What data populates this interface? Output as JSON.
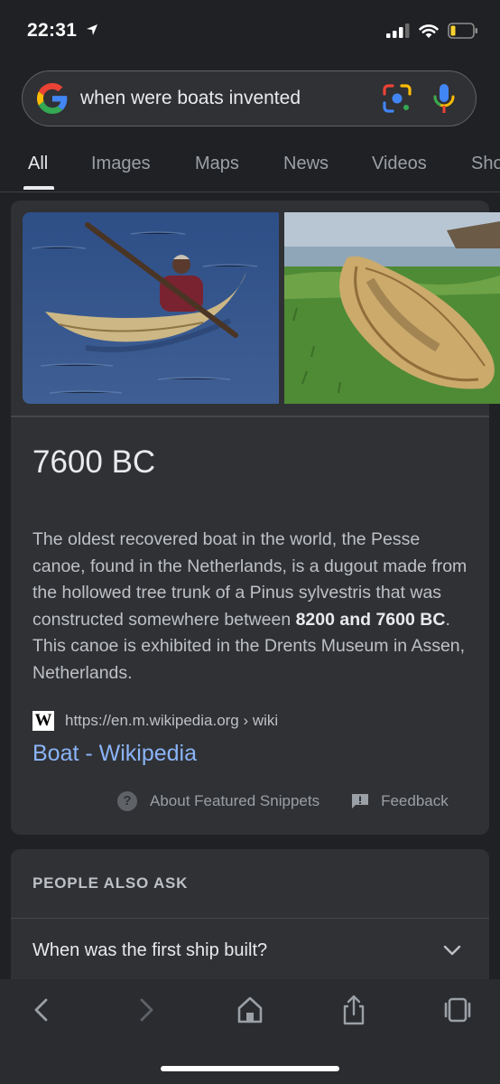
{
  "status": {
    "time": "22:31"
  },
  "search": {
    "query": "when were boats invented"
  },
  "tabs": [
    {
      "label": "All",
      "active": true
    },
    {
      "label": "Images"
    },
    {
      "label": "Maps"
    },
    {
      "label": "News"
    },
    {
      "label": "Videos"
    },
    {
      "label": "Sho"
    }
  ],
  "featured": {
    "answer": "7600 BC",
    "snippet_before": "The oldest recovered boat in the world, the Pesse canoe, found in the Netherlands, is a dugout made from the hollowed tree trunk of a Pinus sylvestris that was constructed somewhere between ",
    "snippet_bold": "8200 and 7600 BC",
    "snippet_after": ". This canoe is exhibited in the Drents Museum in Assen, Netherlands.",
    "source_icon": "W",
    "source_url": "https://en.m.wikipedia.org › wiki",
    "result_title": "Boat - Wikipedia",
    "about_label": "About Featured Snippets",
    "feedback_label": "Feedback"
  },
  "people_also_ask": {
    "heading": "PEOPLE ALSO ASK",
    "questions": [
      "When was the first ship built?"
    ]
  },
  "colors": {
    "background": "#202124",
    "card": "#303134",
    "link": "#8ab4f8"
  },
  "icons": [
    "location-arrow-icon",
    "signal-icon",
    "wifi-icon",
    "battery-icon",
    "google-logo-icon",
    "lens-icon",
    "mic-icon",
    "help-icon",
    "feedback-icon",
    "chevron-down-icon",
    "back-icon",
    "forward-icon",
    "home-icon",
    "share-icon",
    "tabs-icon"
  ]
}
